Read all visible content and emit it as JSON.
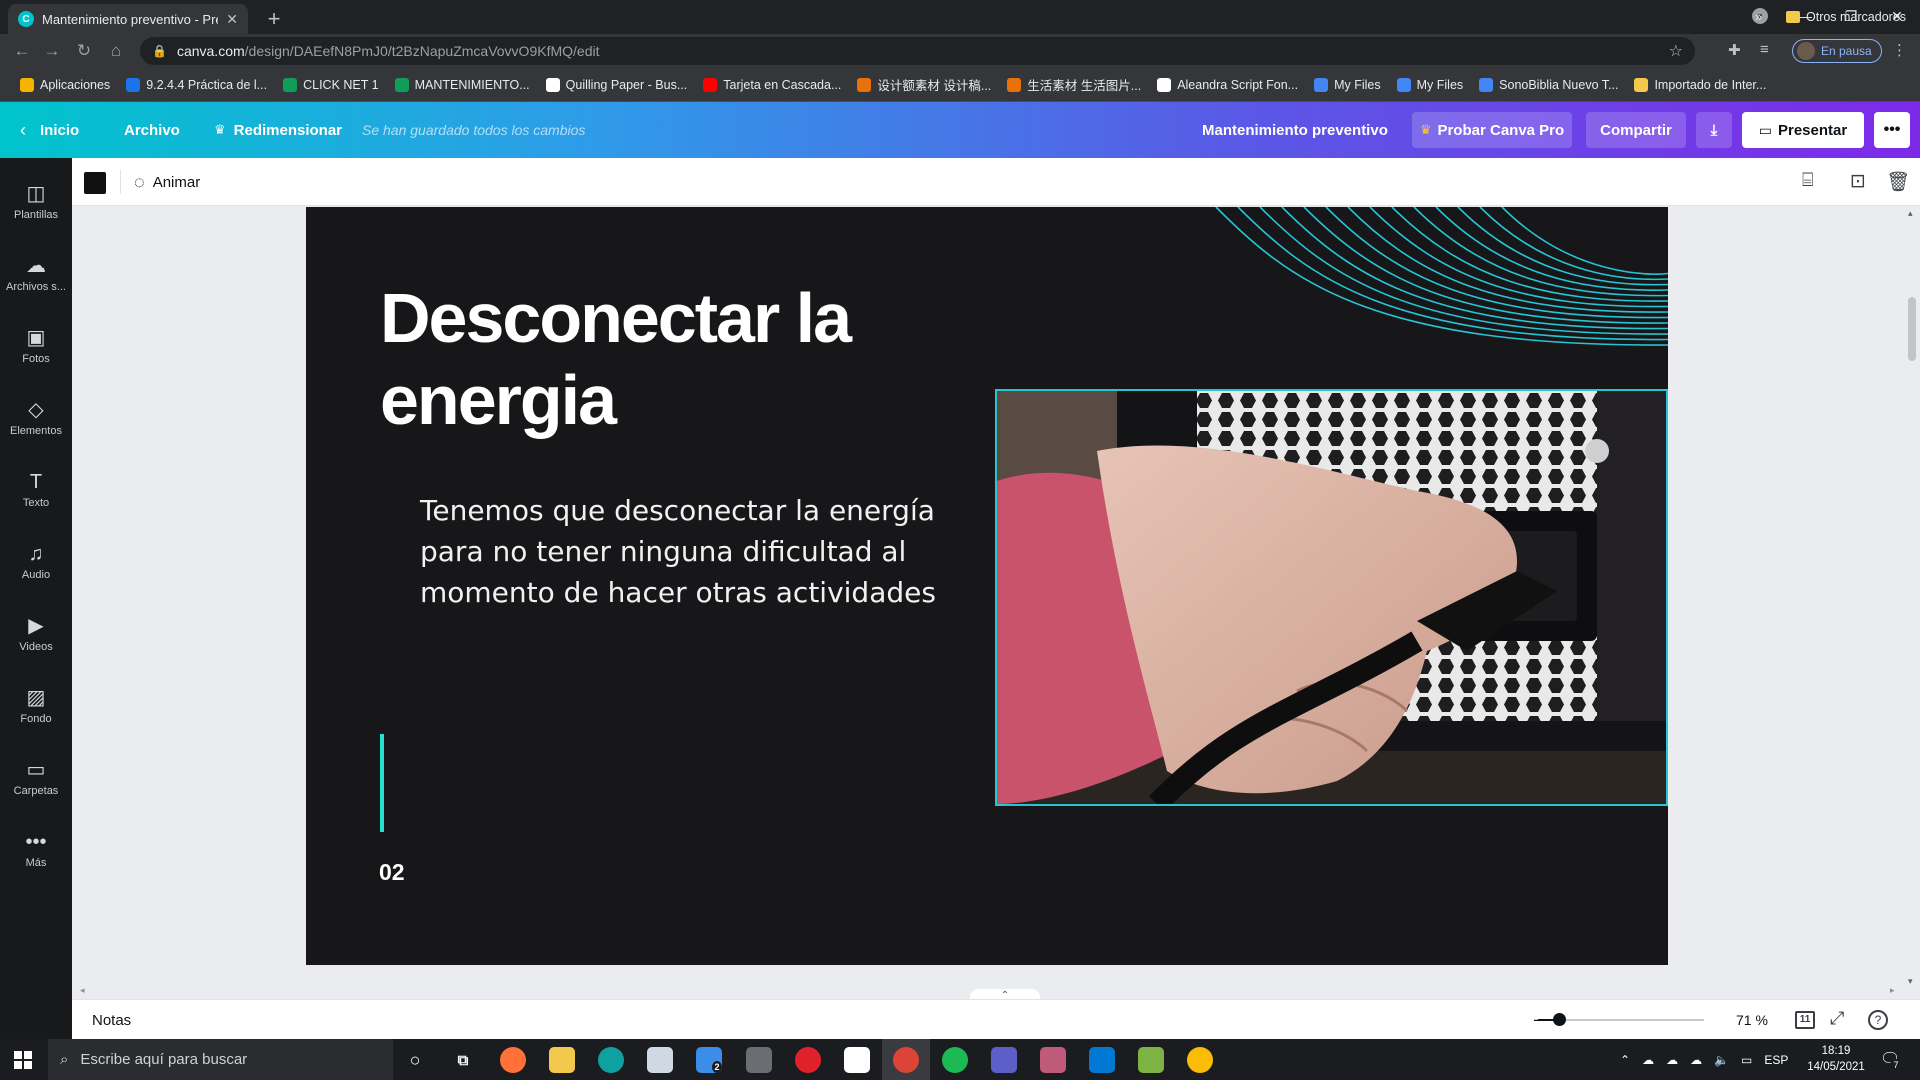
{
  "browser": {
    "tab_title": "Mantenimiento preventivo - Pres",
    "tab_favicon": "C",
    "url_domain": "canva.com",
    "url_path": "/design/DAEefN8PmJ0/t2BzNapuZmcaVovvO9KfMQ/edit",
    "profile_label": "En pausa",
    "bookmarks": [
      {
        "label": "Aplicaciones",
        "icon": "apps-grid-icon",
        "color": "#f4b400"
      },
      {
        "label": "9.2.4.4 Práctica de l...",
        "icon": "cisco-icon",
        "color": "#1a73e8"
      },
      {
        "label": "CLICK NET 1",
        "icon": "drive-icon",
        "color": "#0f9d58"
      },
      {
        "label": "MANTENIMIENTO...",
        "icon": "sheet-icon",
        "color": "#0f9d58"
      },
      {
        "label": "Quilling Paper - Bus...",
        "icon": "google-icon",
        "color": "#ffffff"
      },
      {
        "label": "Tarjeta en Cascada...",
        "icon": "youtube-icon",
        "color": "#ff0000"
      },
      {
        "label": "设计额素材 设计稿...",
        "icon": "site-icon",
        "color": "#e8710a"
      },
      {
        "label": "生活素材 生活图片...",
        "icon": "site-icon",
        "color": "#e8710a"
      },
      {
        "label": "Aleandra Script Fon...",
        "icon": "globe-icon",
        "color": "#ffffff"
      },
      {
        "label": "My Files",
        "icon": "files-icon",
        "color": "#4285f4"
      },
      {
        "label": "My Files",
        "icon": "files-icon",
        "color": "#4285f4"
      },
      {
        "label": "SonoBiblia Nuevo T...",
        "icon": "files-icon",
        "color": "#4285f4"
      },
      {
        "label": "Importado de Inter...",
        "icon": "folder-icon",
        "color": "#f2c94c"
      }
    ],
    "bookmarks_more": "»",
    "other_bookmarks": "Otros marcadores"
  },
  "canva": {
    "home": "Inicio",
    "file": "Archivo",
    "resize": "Redimensionar",
    "saved_status": "Se han guardado todos los cambios",
    "design_name": "Mantenimiento preventivo",
    "try_pro": "Probar Canva Pro",
    "share": "Compartir",
    "present": "Presentar",
    "brand_color": "#00c4cc",
    "accent_color": "#7d2ae8"
  },
  "sidebar": {
    "items": [
      {
        "label": "Plantillas",
        "icon": "templates-icon",
        "glyph": "◫"
      },
      {
        "label": "Archivos s...",
        "icon": "upload-cloud-icon",
        "glyph": "☁"
      },
      {
        "label": "Fotos",
        "icon": "photos-icon",
        "glyph": "▣"
      },
      {
        "label": "Elementos",
        "icon": "elements-icon",
        "glyph": "◇"
      },
      {
        "label": "Texto",
        "icon": "text-icon",
        "glyph": "T"
      },
      {
        "label": "Audio",
        "icon": "audio-icon",
        "glyph": "♫"
      },
      {
        "label": "Videos",
        "icon": "video-icon",
        "glyph": "▶"
      },
      {
        "label": "Fondo",
        "icon": "background-icon",
        "glyph": "▨"
      },
      {
        "label": "Carpetas",
        "icon": "folder-icon",
        "glyph": "▭"
      },
      {
        "label": "Más",
        "icon": "more-icon",
        "glyph": "•••"
      }
    ]
  },
  "toolbar": {
    "color_swatch": "#111111",
    "animate": "Animar"
  },
  "slide": {
    "title": "Desconectar la energia",
    "body": "Tenemos que desconectar la energía para no tener ninguna dificultad al momento de hacer otras actividades",
    "number": "02",
    "background": "#171618",
    "accent": "#27e0d4"
  },
  "bottombar": {
    "notes": "Notas",
    "zoom_percent": 71,
    "zoom_label": "71 %",
    "page_count": "11"
  },
  "taskbar": {
    "search_placeholder": "Escribe aquí para buscar",
    "mail_badge": "2",
    "language": "ESP",
    "time": "18:19",
    "date": "14/05/2021",
    "notifications": "7"
  }
}
